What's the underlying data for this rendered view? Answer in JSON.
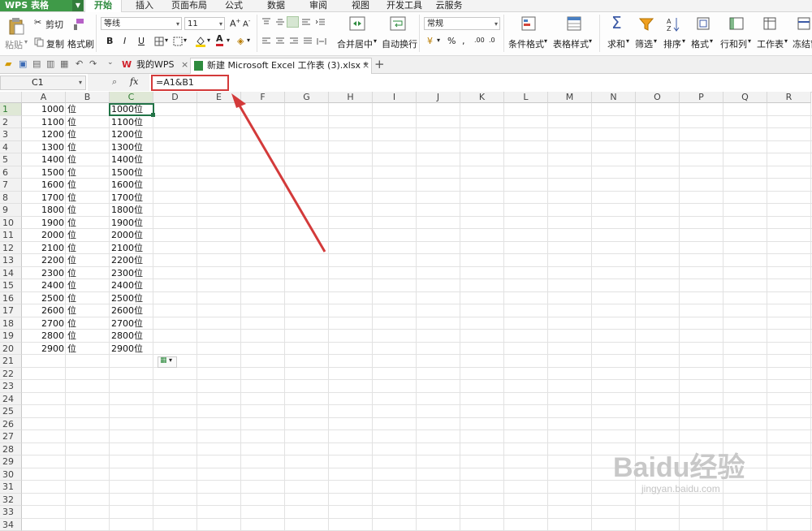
{
  "app": {
    "title": "WPS 表格"
  },
  "menu": [
    "开始",
    "插入",
    "页面布局",
    "公式",
    "数据",
    "审阅",
    "视图",
    "开发工具",
    "云服务"
  ],
  "ribbon": {
    "paste": "粘贴",
    "cut": "剪切",
    "copy": "复制",
    "format_painter": "格式刷",
    "font_name": "等线",
    "font_size": "11",
    "merge_center": "合并居中",
    "wrap_text": "自动换行",
    "number_format": "常规",
    "conditional_format": "条件格式",
    "table_style": "表格样式",
    "sum": "求和",
    "filter": "筛选",
    "sort": "排序",
    "format": "格式",
    "row_col": "行和列",
    "worksheet": "工作表",
    "freeze": "冻结窗"
  },
  "tabs": {
    "home": "我的WPS",
    "doc": "新建 Microsoft Excel 工作表 (3).xlsx *"
  },
  "formula_bar": {
    "name_box": "C1",
    "fx": "fx",
    "formula": "=A1&B1"
  },
  "columns": [
    "A",
    "B",
    "C",
    "D",
    "E",
    "F",
    "G",
    "H",
    "I",
    "J",
    "K",
    "L",
    "M",
    "N",
    "O",
    "P",
    "Q",
    "R"
  ],
  "rows": [
    {
      "a": "1000",
      "b": "位",
      "c": "1000位"
    },
    {
      "a": "1100",
      "b": "位",
      "c": "1100位"
    },
    {
      "a": "1200",
      "b": "位",
      "c": "1200位"
    },
    {
      "a": "1300",
      "b": "位",
      "c": "1300位"
    },
    {
      "a": "1400",
      "b": "位",
      "c": "1400位"
    },
    {
      "a": "1500",
      "b": "位",
      "c": "1500位"
    },
    {
      "a": "1600",
      "b": "位",
      "c": "1600位"
    },
    {
      "a": "1700",
      "b": "位",
      "c": "1700位"
    },
    {
      "a": "1800",
      "b": "位",
      "c": "1800位"
    },
    {
      "a": "1900",
      "b": "位",
      "c": "1900位"
    },
    {
      "a": "2000",
      "b": "位",
      "c": "2000位"
    },
    {
      "a": "2100",
      "b": "位",
      "c": "2100位"
    },
    {
      "a": "2200",
      "b": "位",
      "c": "2200位"
    },
    {
      "a": "2300",
      "b": "位",
      "c": "2300位"
    },
    {
      "a": "2400",
      "b": "位",
      "c": "2400位"
    },
    {
      "a": "2500",
      "b": "位",
      "c": "2500位"
    },
    {
      "a": "2600",
      "b": "位",
      "c": "2600位"
    },
    {
      "a": "2700",
      "b": "位",
      "c": "2700位"
    },
    {
      "a": "2800",
      "b": "位",
      "c": "2800位"
    },
    {
      "a": "2900",
      "b": "位",
      "c": "2900位"
    }
  ],
  "row_numbers": [
    "1",
    "2",
    "3",
    "4",
    "5",
    "6",
    "7",
    "8",
    "9",
    "10",
    "11",
    "12",
    "13",
    "14",
    "15",
    "16",
    "17",
    "18",
    "19",
    "20",
    "21",
    "22",
    "23",
    "24",
    "25",
    "26",
    "27",
    "28",
    "29",
    "30",
    "31",
    "32",
    "33",
    "34"
  ],
  "watermark": {
    "brand": "Baidu经验",
    "url": "jingyan.baidu.com"
  },
  "colors": {
    "accent": "#2e8b3e",
    "highlight": "#d33a3a",
    "selection": "#217346"
  }
}
